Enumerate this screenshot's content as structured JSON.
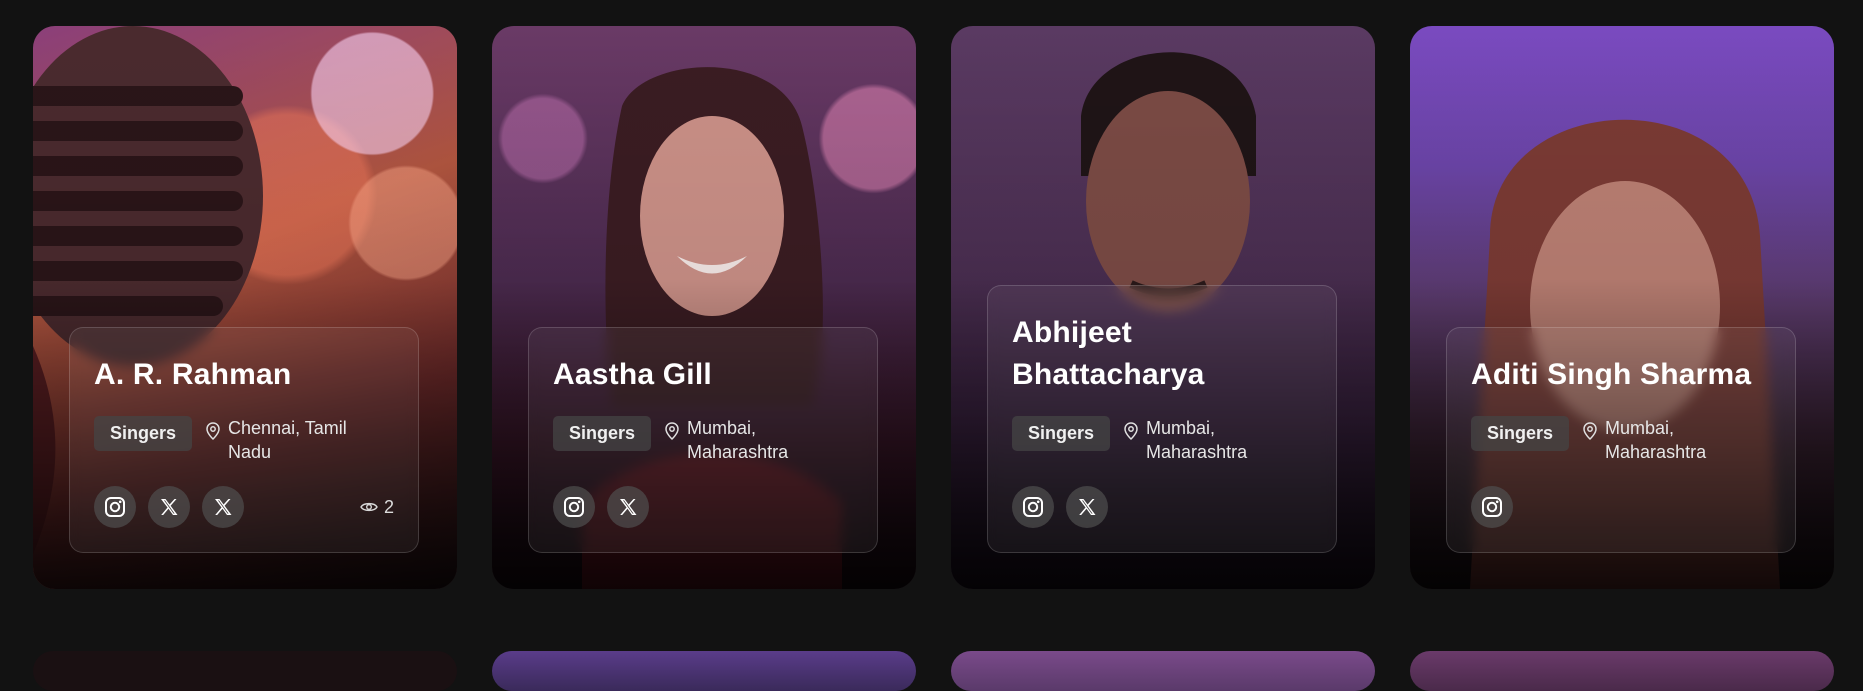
{
  "cards": [
    {
      "name": "A. R. Rahman",
      "category": "Singers",
      "location": "Chennai, Tamil Nadu",
      "socials": [
        "instagram-icon",
        "x-icon",
        "x-icon"
      ],
      "views": "2"
    },
    {
      "name": "Aastha Gill",
      "category": "Singers",
      "location": "Mumbai, Maharashtra",
      "socials": [
        "instagram-icon",
        "x-icon"
      ]
    },
    {
      "name": "Abhijeet Bhattacharya",
      "category": "Singers",
      "location": "Mumbai, Maharashtra",
      "socials": [
        "instagram-icon",
        "x-icon"
      ]
    },
    {
      "name": "Aditi Singh Sharma",
      "category": "Singers",
      "location": "Mumbai, Maharashtra",
      "socials": [
        "instagram-icon"
      ]
    }
  ],
  "colors": {
    "page_background": "#121212",
    "badge_background": "#464646"
  }
}
